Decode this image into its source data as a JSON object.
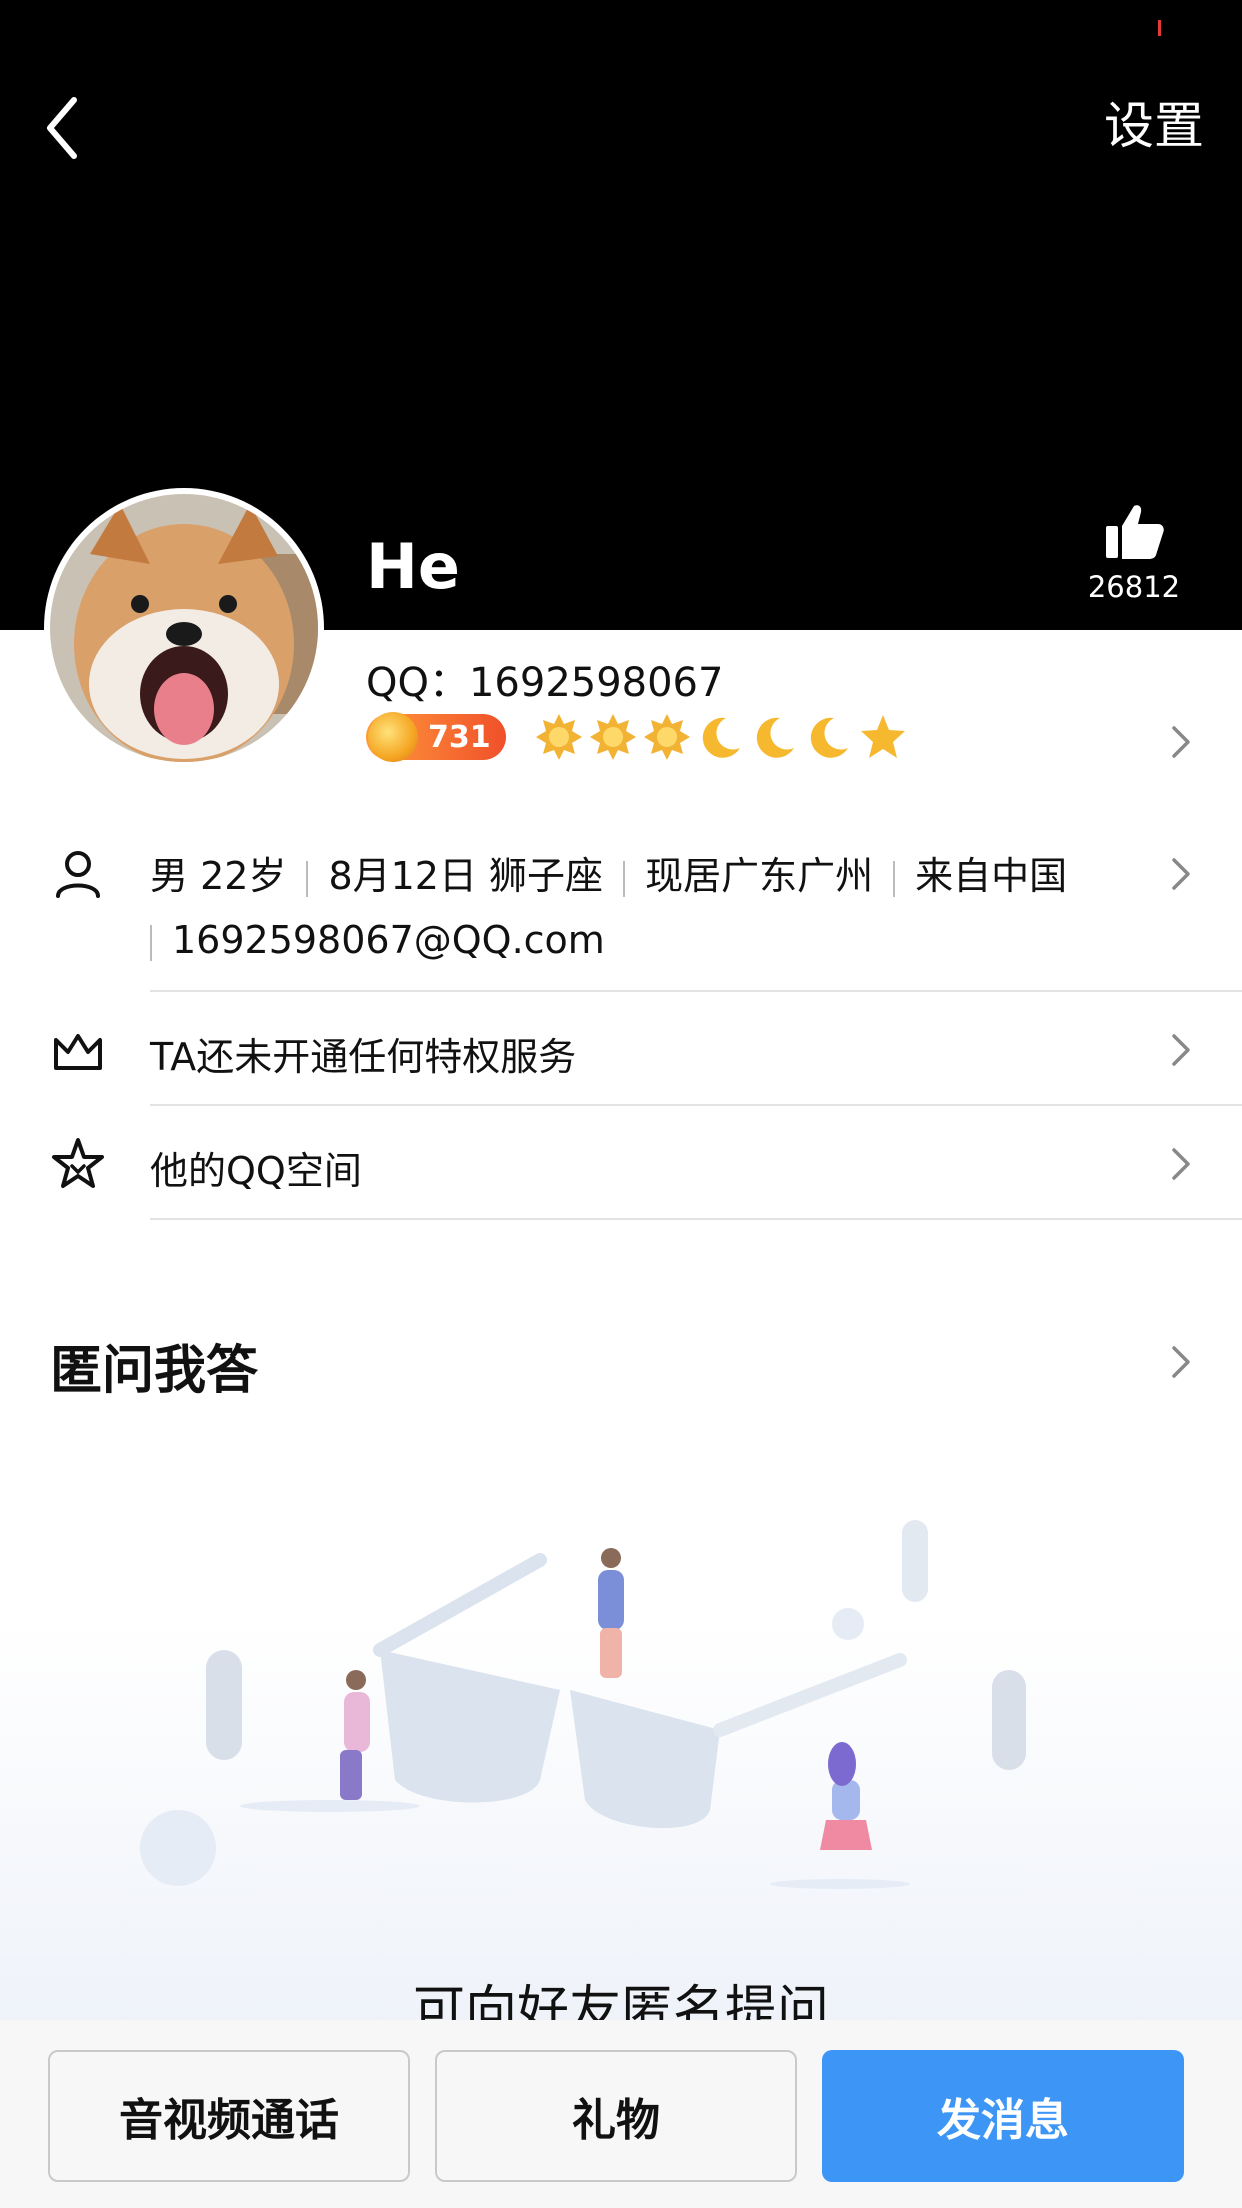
{
  "header": {
    "settings_label": "设置",
    "like_count": "26812"
  },
  "profile": {
    "nickname": "He",
    "qq_line": "QQ：1692598067",
    "level_number": "731"
  },
  "info": {
    "gender_age": "男 22岁",
    "birthday": "8月12日 狮子座",
    "residence": "现居广东广州",
    "origin": "来自中国",
    "email": "1692598067@QQ.com"
  },
  "rows": {
    "privilege": "TA还未开通任何特权服务",
    "qzone": "他的QQ空间"
  },
  "section": {
    "title": "匿问我答",
    "prompt": "可向好友匿名提问"
  },
  "actions": {
    "call": "音视频通话",
    "gift": "礼物",
    "message": "发消息"
  },
  "colors": {
    "primary": "#3d96f5",
    "cover": "#000000"
  },
  "icons": {
    "back": "back-arrow-icon",
    "like": "thumbs-up-icon",
    "person": "person-icon",
    "crown": "crown-icon",
    "star": "star-icon",
    "chevron": "chevron-right-icon"
  }
}
